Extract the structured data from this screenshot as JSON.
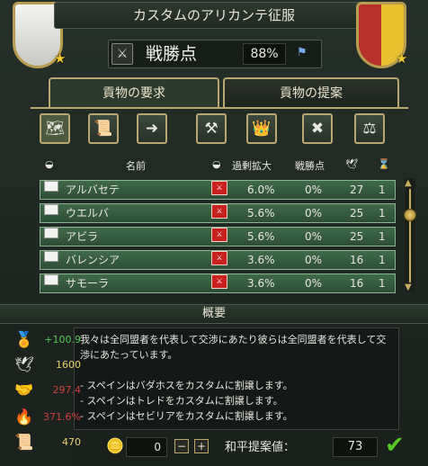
{
  "window": {
    "title": "カスタムのアリカンテ征服"
  },
  "warscore": {
    "label": "戦勝点",
    "value": "88%"
  },
  "tabs": [
    {
      "label": "貢物の要求"
    },
    {
      "label": "貢物の提案"
    }
  ],
  "table": {
    "headers": {
      "name": "名前",
      "overextension": "過剰拡大",
      "warscore": "戦勝点"
    },
    "rows": [
      {
        "name": "アルバセテ",
        "overextension": "6.0%",
        "warscore": "0%",
        "dev": "27",
        "score": "1"
      },
      {
        "name": "ウエルバ",
        "overextension": "5.6%",
        "warscore": "0%",
        "dev": "25",
        "score": "1"
      },
      {
        "name": "アビラ",
        "overextension": "5.6%",
        "warscore": "0%",
        "dev": "25",
        "score": "1"
      },
      {
        "name": "バレンシア",
        "overextension": "3.6%",
        "warscore": "0%",
        "dev": "16",
        "score": "1"
      },
      {
        "name": "サモーラ",
        "overextension": "3.6%",
        "warscore": "0%",
        "dev": "16",
        "score": "1"
      }
    ]
  },
  "summary": {
    "header": "概要",
    "text": "我々は全同盟者を代表して交渉にあたり彼らは全同盟者を代表して交渉にあたっています。\n\n- スペインはバダホスをカスタムに割譲します。\n- スペインはトレドをカスタムに割譲します。\n- スペインはセビリアをカスタムに割譲します。"
  },
  "stats": [
    {
      "icon": "prestige-icon",
      "value": "+100.9",
      "color": "#50c850"
    },
    {
      "icon": "dove-icon",
      "value": "1600",
      "color": "#e8d070"
    },
    {
      "icon": "trust-icon",
      "value": "297.4",
      "color": "#d04040"
    },
    {
      "icon": "aggressive-expansion-icon",
      "value": "371.6%",
      "color": "#d04040"
    },
    {
      "icon": "scroll-icon",
      "value": "470",
      "color": "#e8d070"
    }
  ],
  "peace": {
    "gold_amount": "0",
    "minus": "−",
    "plus": "+",
    "accept_label": "和平提案値：",
    "accept_value": "73"
  },
  "colors": {
    "accent": "#b8a870",
    "row": "#3f6a48"
  }
}
